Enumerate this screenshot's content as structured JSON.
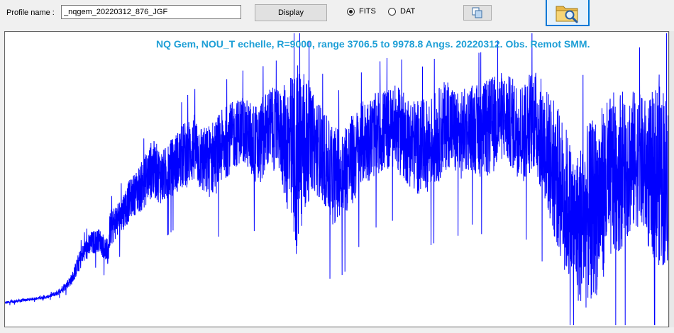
{
  "toolbar": {
    "profile_label": "Profile name :",
    "profile_value": "_nqgem_20220312_876_JGF",
    "display_label": "Display",
    "radio_fits": "FITS",
    "radio_dat": "DAT",
    "selected_format": "FITS",
    "copy_icon": "copy-icon",
    "open_icon": "folder-search-icon"
  },
  "plot": {
    "title": "NQ Gem, NOU_T echelle, R=9000, range 3706.5 to 9978.8 Angs.    20220312.   Obs. Remot SMM.",
    "line_color": "#0000ff",
    "title_color": "#1e9fd6"
  },
  "chart_data": {
    "type": "line",
    "title": "NQ Gem, NOU_T echelle, R=9000, range 3706.5 to 9978.8 Angs.    20220312.   Obs. Remot SMM.",
    "xlabel": "",
    "ylabel": "",
    "xlim": [
      3706.5,
      9978.8
    ],
    "grid": false,
    "series": [
      {
        "envelope": {
          "x": [
            3706.5,
            3900,
            4100,
            4200,
            4280,
            4340,
            4400,
            4460,
            4520,
            4600,
            4680,
            4700,
            4750,
            4800,
            4860,
            4900,
            5000,
            5100,
            5200,
            5300,
            5400,
            5500,
            5600,
            5700,
            5800,
            5900,
            5950,
            6000,
            6100,
            6200,
            6300,
            6400,
            6460,
            6500,
            6560,
            6600,
            6700,
            6800,
            6900,
            7000,
            7100,
            7200,
            7300,
            7400,
            7500,
            7600,
            7700,
            7800,
            7900,
            8000,
            8100,
            8200,
            8300,
            8400,
            8500,
            8600,
            8700,
            8800,
            8900,
            9000,
            9100,
            9200,
            9300,
            9400,
            9500,
            9600,
            9700,
            9800,
            9900,
            9978.8
          ],
          "high": [
            0.08,
            0.09,
            0.1,
            0.12,
            0.15,
            0.18,
            0.25,
            0.3,
            0.33,
            0.34,
            0.3,
            0.4,
            0.43,
            0.45,
            0.5,
            0.52,
            0.58,
            0.66,
            0.62,
            0.67,
            0.72,
            0.75,
            0.7,
            0.74,
            0.78,
            0.8,
            0.82,
            0.8,
            0.78,
            0.85,
            0.83,
            0.88,
            0.93,
            0.95,
            0.9,
            0.83,
            0.78,
            0.7,
            0.72,
            0.75,
            0.8,
            0.82,
            0.84,
            0.85,
            0.82,
            0.8,
            0.8,
            0.84,
            0.88,
            0.82,
            0.86,
            0.85,
            0.88,
            0.9,
            0.88,
            0.86,
            0.92,
            0.86,
            0.8,
            0.72,
            0.6,
            0.7,
            0.75,
            0.8,
            0.84,
            0.85,
            0.82,
            0.8,
            0.9,
            0.8
          ],
          "low": [
            0.07,
            0.08,
            0.09,
            0.1,
            0.12,
            0.14,
            0.18,
            0.22,
            0.24,
            0.26,
            0.2,
            0.27,
            0.3,
            0.32,
            0.35,
            0.38,
            0.4,
            0.45,
            0.42,
            0.46,
            0.48,
            0.5,
            0.44,
            0.46,
            0.52,
            0.56,
            0.58,
            0.54,
            0.48,
            0.55,
            0.54,
            0.35,
            0.22,
            0.25,
            0.4,
            0.48,
            0.44,
            0.35,
            0.38,
            0.42,
            0.5,
            0.52,
            0.54,
            0.55,
            0.5,
            0.46,
            0.47,
            0.5,
            0.56,
            0.5,
            0.55,
            0.52,
            0.52,
            0.58,
            0.55,
            0.5,
            0.55,
            0.45,
            0.3,
            0.18,
            0.08,
            0.05,
            0.1,
            0.2,
            0.25,
            0.3,
            0.35,
            0.25,
            0.2,
            0.2
          ]
        }
      }
    ]
  }
}
